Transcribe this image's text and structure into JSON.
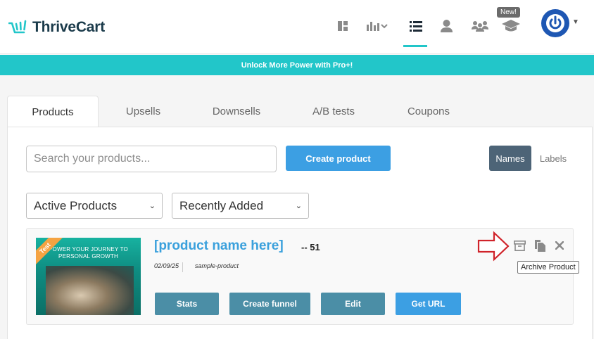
{
  "brand": {
    "name": "ThriveCart"
  },
  "nav": {
    "icons": [
      "dashboard-icon",
      "analytics-icon",
      "products-list-icon",
      "user-icon",
      "affiliates-icon",
      "learn-cap-icon"
    ],
    "new_badge": "New!"
  },
  "banner": {
    "text": "Unlock More Power with Pro+!"
  },
  "tabs": [
    {
      "label": "Products",
      "active": true
    },
    {
      "label": "Upsells"
    },
    {
      "label": "Downsells"
    },
    {
      "label": "A/B tests"
    },
    {
      "label": "Coupons"
    }
  ],
  "toolbar": {
    "search_placeholder": "Search your products...",
    "create_label": "Create product",
    "view_names": "Names",
    "view_labels": "Labels"
  },
  "filters": {
    "status": "Active Products",
    "sort": "Recently Added"
  },
  "product": {
    "name": "[product name here]",
    "id": "-- 51",
    "date": "02/09/25",
    "slug": "sample-product",
    "ribbon": "Test",
    "thumb_headline": "POWER YOUR JOURNEY TO PERSONAL GROWTH",
    "buttons": {
      "stats": "Stats",
      "funnel": "Create funnel",
      "edit": "Edit",
      "geturl": "Get URL"
    },
    "tooltip": "Archive Product"
  },
  "colors": {
    "accent": "#22c6c9",
    "primary": "#3c9fe3",
    "slate": "#4b8ea6",
    "link": "#3aa0dc"
  }
}
